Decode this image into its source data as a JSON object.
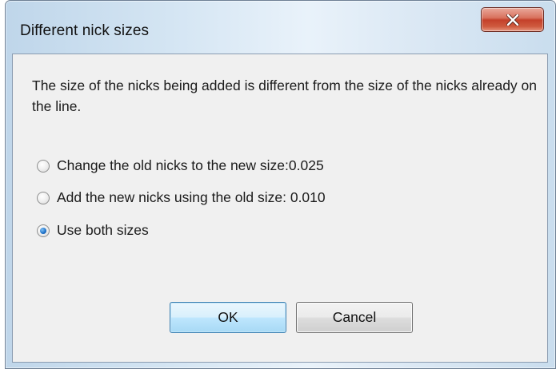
{
  "dialog": {
    "title": "Different nick sizes",
    "close_icon": "close-x-icon",
    "message": "The size of the nicks being added is different from the size of the nicks already on the line.",
    "options": [
      {
        "label": "Change the old nicks to the new size:0.025",
        "checked": false
      },
      {
        "label": "Add the new nicks using the old size: 0.010",
        "checked": false
      },
      {
        "label": "Use both sizes",
        "checked": true
      }
    ],
    "ok_label": "OK",
    "cancel_label": "Cancel"
  },
  "colors": {
    "close_button": "#c4412a",
    "default_button_border": "#3c7fb1",
    "client_bg": "#f0f0f0"
  }
}
